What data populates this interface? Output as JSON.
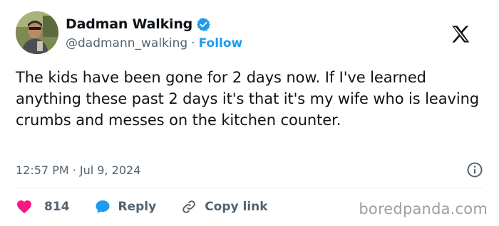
{
  "author": {
    "display_name": "Dadman Walking",
    "handle": "@dadmann_walking",
    "separator": "·",
    "follow_label": "Follow"
  },
  "tweet": {
    "text": "The kids have been gone for 2 days now. If I've learned anything these past 2 days it's that it's my wife who is leaving crumbs and messes on the kitchen counter.",
    "timestamp": "12:57 PM · Jul 9, 2024"
  },
  "actions": {
    "like_count": "814",
    "reply_label": "Reply",
    "copy_link_label": "Copy link"
  },
  "icons": {
    "verified": "verified-badge-icon",
    "platform": "x-logo-icon",
    "info": "info-icon",
    "like": "heart-icon",
    "reply": "speech-bubble-icon",
    "copy_link": "link-icon"
  },
  "colors": {
    "accent": "#1d9bf0",
    "like": "#f91880",
    "text": "#0f1419",
    "secondary": "#536471"
  },
  "watermark": "boredpanda.com"
}
